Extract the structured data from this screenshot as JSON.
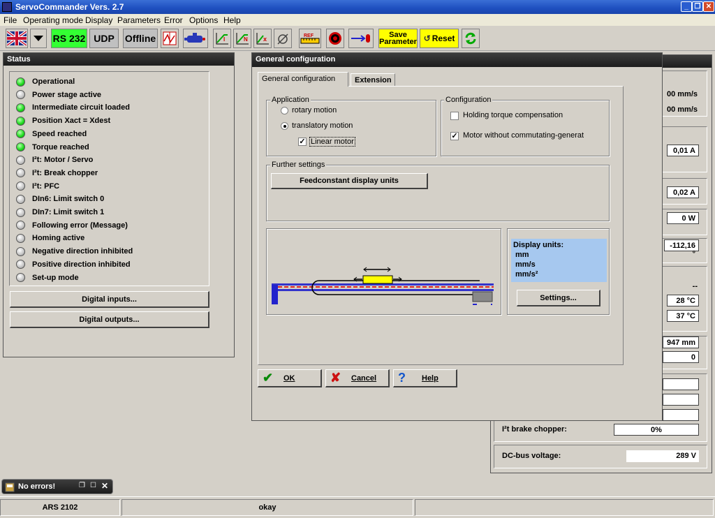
{
  "titlebar": {
    "title": "ServoCommander Vers. 2.7"
  },
  "menu": [
    "File",
    "Operating mode",
    "Display",
    "Parameters",
    "Error",
    "Options",
    "Help"
  ],
  "toolbar": {
    "rs232": "RS 232",
    "udp": "UDP",
    "offline": "Offline",
    "save_line1": "Save",
    "save_line2": "Parameter",
    "reset": "Reset"
  },
  "status_window": {
    "title": "Status",
    "items": [
      {
        "label": "Operational",
        "on": true
      },
      {
        "label": "Power stage active",
        "on": false
      },
      {
        "label": "Intermediate circuit loaded",
        "on": true
      },
      {
        "label": "Position Xact = Xdest",
        "on": true
      },
      {
        "label": "Speed reached",
        "on": true
      },
      {
        "label": "Torque reached",
        "on": true
      },
      {
        "label": "I²t: Motor / Servo",
        "on": false
      },
      {
        "label": "I²t: Break chopper",
        "on": false
      },
      {
        "label": "I²t: PFC",
        "on": false
      },
      {
        "label": "DIn6: Limit switch 0",
        "on": false
      },
      {
        "label": "DIn7: Limit switch 1",
        "on": false
      },
      {
        "label": "Following error (Message)",
        "on": false
      },
      {
        "label": "Homing active",
        "on": false
      },
      {
        "label": "Negative direction inhibited",
        "on": false
      },
      {
        "label": "Positive direction inhibited",
        "on": false
      },
      {
        "label": "Set-up mode",
        "on": false
      }
    ],
    "digital_inputs": "Digital inputs...",
    "digital_outputs": "Digital outputs..."
  },
  "right_panel": {
    "v1": "00 mm/s",
    "v2": "00 mm/s",
    "v3": "0,01 A",
    "v4": "0,02 A",
    "v5": "0 W",
    "v6": "-112,16 °",
    "v7": "--",
    "v8": "28 °C",
    "v9": "37 °C",
    "v10": "947 mm",
    "v11": "0",
    "brake_label": "I²t brake chopper:",
    "brake_value": "0%",
    "dc_label": "DC-bus voltage:",
    "dc_value": "289 V"
  },
  "dialog": {
    "title": "General configuration",
    "tabs": [
      "General configuration",
      "Extension"
    ],
    "application_label": "Application",
    "rotary": "rotary motion",
    "translatory": "translatory motion",
    "linear": "Linear motor",
    "configuration_label": "Configuration",
    "holding": "Holding torque compensation",
    "motor_wo": "Motor without commutating-generat",
    "further_label": "Further settings",
    "feedconstant": "Feedconstant display units",
    "display_units_title": "Display units:",
    "unit1": "mm",
    "unit2": "mm/s",
    "unit3": "mm/s²",
    "settings": "Settings...",
    "ok": "OK",
    "cancel": "Cancel",
    "help": "Help"
  },
  "error_window": {
    "title": "No errors!"
  },
  "statusbar": {
    "device": "ARS 2102",
    "state": "okay"
  },
  "colors": {
    "title_blue": "#1e4fbf",
    "led_green": "#22dd22",
    "units_bg": "#a6c8ef",
    "toolbar_green": "#33ff33",
    "toolbar_yellow": "#ffff00"
  }
}
